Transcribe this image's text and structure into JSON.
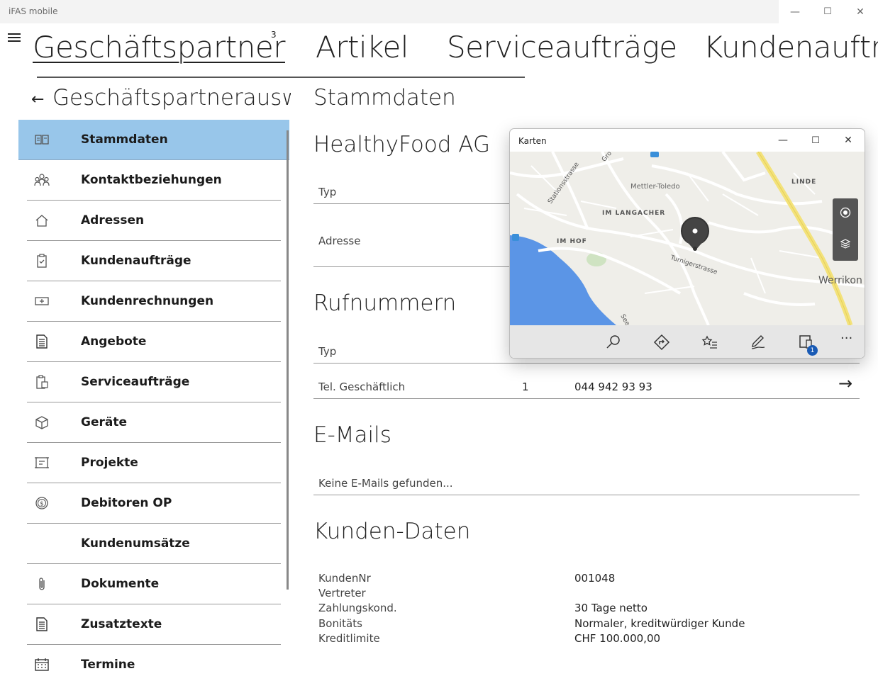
{
  "window": {
    "title": "iFAS mobile",
    "minimize": "—",
    "maximize": "☐",
    "close": "✕"
  },
  "topnav": {
    "items": [
      "Geschäftspartner",
      "Artikel",
      "Serviceaufträge",
      "Kundenaufträge"
    ],
    "badge": "3"
  },
  "left": {
    "back": "←",
    "title": "Geschäftspartnerauswahl",
    "menu": [
      {
        "label": "Stammdaten",
        "icon": "book-icon"
      },
      {
        "label": "Kontaktbeziehungen",
        "icon": "people-icon"
      },
      {
        "label": "Adressen",
        "icon": "home-icon"
      },
      {
        "label": "Kundenaufträge",
        "icon": "clipboard-check-icon"
      },
      {
        "label": "Kundenrechnungen",
        "icon": "invoice-icon"
      },
      {
        "label": "Angebote",
        "icon": "document-list-icon"
      },
      {
        "label": "Serviceaufträge",
        "icon": "service-clipboard-icon"
      },
      {
        "label": "Geräte",
        "icon": "box-icon"
      },
      {
        "label": "Projekte",
        "icon": "project-icon"
      },
      {
        "label": "Debitoren OP",
        "icon": "coin-icon"
      },
      {
        "label": "Kundenumsätze",
        "icon": ""
      },
      {
        "label": "Dokumente",
        "icon": "paperclip-icon"
      },
      {
        "label": "Zusatztexte",
        "icon": "text-document-icon"
      },
      {
        "label": "Termine",
        "icon": "calendar-icon"
      }
    ]
  },
  "content": {
    "page_title": "Stammdaten",
    "company": "HealthyFood AG",
    "typ_label": "Typ",
    "adresse_label": "Adresse",
    "phones": {
      "title": "Rufnummern",
      "header_typ": "Typ",
      "rows": [
        {
          "type": "Tel. Geschäftlich",
          "nr": "1",
          "number": "044 942 93 93",
          "arrow": "→"
        }
      ]
    },
    "emails": {
      "title": "E-Mails",
      "empty": "Keine E-Mails gefunden..."
    },
    "customer": {
      "title": "Kunden-Daten",
      "rows": [
        {
          "label": "KundenNr",
          "value": "001048"
        },
        {
          "label": "Vertreter",
          "value": ""
        },
        {
          "label": "Zahlungskond.",
          "value": "30 Tage netto"
        },
        {
          "label": "Bonitäts",
          "value": "Normaler, kreditwürdiger Kunde"
        },
        {
          "label": "Kreditlimite",
          "value": "CHF 100.000,00"
        }
      ]
    }
  },
  "maps": {
    "title": "Karten",
    "labels": [
      "Mettler-Toledo",
      "IM LANGACHER",
      "IM HOF",
      "LINDE",
      "Werrikon",
      "Stationsstrasse",
      "Turnigerstrasse",
      "Gro",
      "See"
    ],
    "toolbar_badge": "1",
    "water": "#5b95e6",
    "land": "#efeee9",
    "road_major": "#f3e27a"
  }
}
